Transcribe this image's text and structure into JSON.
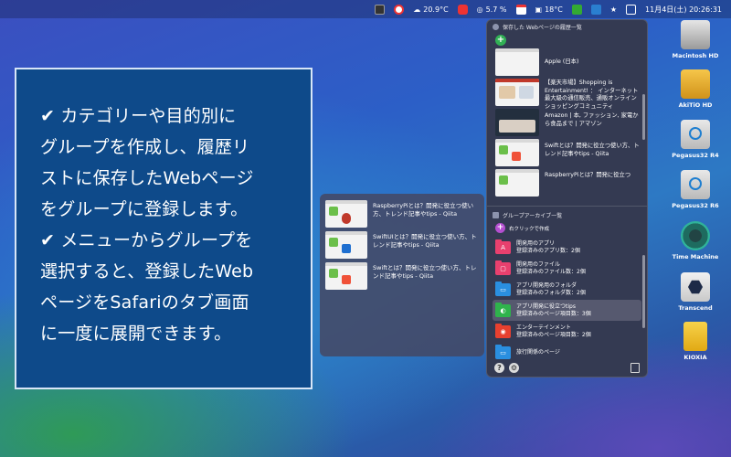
{
  "menubar": {
    "temp_outside": "20.9°C",
    "cpu": "5.7 %",
    "temp_inside": "18°C",
    "datetime": "11月4日(土)  20:26:31"
  },
  "description": {
    "line1": "✔ カテゴリーや目的別に",
    "line2": "グループを作成し、履歴リ",
    "line3": "ストに保存したWebページ",
    "line4": "をグループに登録します。",
    "line5": "✔ メニューからグループを",
    "line6": "選択すると、登録したWeb",
    "line7": "ページをSafariのタブ画面",
    "line8": "に一度に展開できます。"
  },
  "subpanel": {
    "items": [
      {
        "title": "RaspberryPiとは？開発に役立つ使い方、トレンド記事やtips - Qiita"
      },
      {
        "title": "SwiftUIとは？開発に役立つ使い方、トレンド記事やtips - Qiita"
      },
      {
        "title": "Swiftとは？開発に役立つ使い方、トレンド記事やtips - Qiita"
      }
    ]
  },
  "panel": {
    "history_header": "保存した Webページの履歴一覧",
    "history": [
      {
        "title": "Apple (日本)"
      },
      {
        "title": "【楽天市場】Shopping is Entertainment! ： インターネット最大級の通信販売、通販オンラインショッピングコミュニティ"
      },
      {
        "title": "Amazon | 本, ファッション, 家電から食品まで | アマゾン"
      },
      {
        "title": "Swiftとは？開発に役立つ使い方、トレンド記事やtips - Qiita"
      },
      {
        "title": "RaspberryPiとは？開発に役立つ"
      }
    ],
    "archive_header": "グループアーカイブ一覧",
    "archive_add": "右クリックで作成",
    "groups": [
      {
        "name": "開発用のアプリ",
        "count": "登録済みのアプリ数：2個",
        "color": "#e8406e",
        "glyph": "A"
      },
      {
        "name": "開発用のファイル",
        "count": "登録済みのファイル数：2個",
        "color": "#e8406e",
        "glyph": "▢"
      },
      {
        "name": "アプリ開発用のフォルダ",
        "count": "登録済みのフォルダ数：2個",
        "color": "#2a8fe0",
        "glyph": "▭"
      },
      {
        "name": "アプリ開発に役立つtips",
        "count": "登録済みのページ項目数：3個",
        "color": "#2fb34c",
        "glyph": "◐"
      },
      {
        "name": "エンターテインメント",
        "count": "登録済みのページ項目数：2個",
        "color": "#e8402f",
        "glyph": "◉"
      },
      {
        "name": "旅行関係のページ",
        "count": "",
        "color": "#2a8fe0",
        "glyph": "▭"
      }
    ]
  },
  "desktop": {
    "icons": [
      {
        "label": "Macintosh HD"
      },
      {
        "label": "AkiTiO HD"
      },
      {
        "label": "Pegasus32 R4"
      },
      {
        "label": "Pegasus32 R6"
      },
      {
        "label": "Time Machine"
      },
      {
        "label": "Transcend"
      },
      {
        "label": "KIOXIA"
      }
    ]
  }
}
